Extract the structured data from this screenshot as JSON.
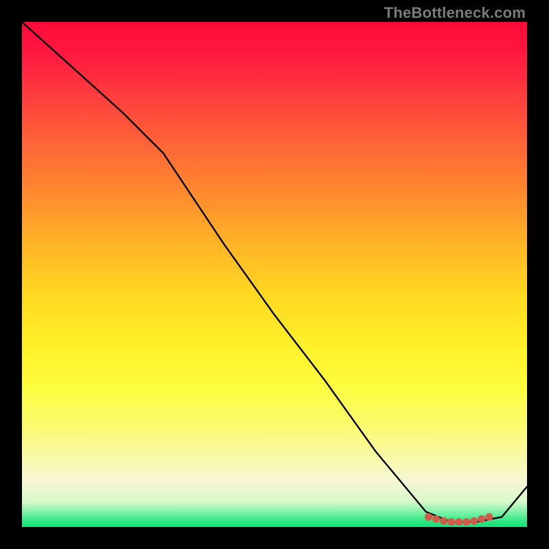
{
  "watermark": "TheBottleneck.com",
  "chart_data": {
    "type": "line",
    "title": "",
    "xlabel": "",
    "ylabel": "",
    "xlim": [
      0,
      100
    ],
    "ylim": [
      0,
      100
    ],
    "grid": false,
    "curve": {
      "name": "bottleneck-curve",
      "x": [
        0,
        10,
        20,
        28,
        40,
        50,
        60,
        70,
        80,
        85,
        90,
        95,
        100
      ],
      "y": [
        100,
        91,
        82,
        74,
        56,
        42,
        29,
        15,
        3,
        1,
        1,
        2,
        8
      ]
    },
    "markers": {
      "name": "optimal-range",
      "color": "#d45a4a",
      "points": [
        {
          "x": 80.5,
          "y": 2.0
        },
        {
          "x": 82.0,
          "y": 1.6
        },
        {
          "x": 83.5,
          "y": 1.2
        },
        {
          "x": 85.0,
          "y": 1.0
        },
        {
          "x": 86.5,
          "y": 1.0
        },
        {
          "x": 88.0,
          "y": 1.0
        },
        {
          "x": 89.5,
          "y": 1.2
        },
        {
          "x": 91.0,
          "y": 1.6
        },
        {
          "x": 92.5,
          "y": 2.0
        }
      ]
    },
    "background_gradient": {
      "top": "#ff0a3a",
      "mid_upper": "#ffb426",
      "mid": "#fff028",
      "mid_lower": "#f6f6d6",
      "bottom": "#12df76"
    }
  }
}
